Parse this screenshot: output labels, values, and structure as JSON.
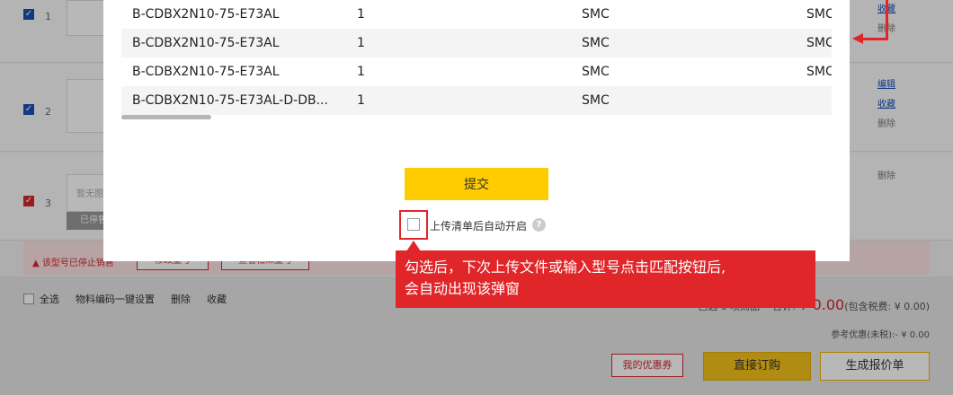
{
  "cart": {
    "rows": [
      {
        "index": "1",
        "links": [
          "收藏",
          "删除"
        ]
      },
      {
        "index": "2",
        "links": [
          "编辑",
          "收藏",
          "删除"
        ]
      },
      {
        "index": "3",
        "links": [
          "删除"
        ],
        "thumb_text": "暂无图",
        "status": "已停售"
      }
    ],
    "warning": {
      "text": "该型号已停止销售",
      "buttons": [
        "修改型号",
        "查看相似型号"
      ]
    }
  },
  "footer": {
    "select_all": "全选",
    "actions": [
      "物料编码一键设置",
      "删除",
      "收藏"
    ],
    "selected_prefix": "已选",
    "selected_count": "0",
    "selected_suffix": "项商品",
    "total_label": "合计:",
    "total": "¥ 0.00",
    "tax_note": "(包含税费: ¥ 0.00)",
    "ref_discount": "参考优惠(未税):- ¥ 0.00",
    "coupon": "我的优惠券",
    "order_btn": "直接订购",
    "quote_btn": "生成报价单"
  },
  "modal": {
    "rows": [
      {
        "model": "B-CDBX2N10-75-E73AL",
        "qty": "1",
        "brand": "SMC",
        "brand2": "SMC"
      },
      {
        "model": "B-CDBX2N10-75-E73AL",
        "qty": "1",
        "brand": "SMC",
        "brand2": "SMC"
      },
      {
        "model": "B-CDBX2N10-75-E73AL",
        "qty": "1",
        "brand": "SMC",
        "brand2": "SMC"
      },
      {
        "model": "B-CDBX2N10-75-E73AL-D-DB...",
        "qty": "1",
        "brand": "SMC",
        "brand2": ""
      }
    ],
    "submit": "提交",
    "auto_open_label": "上传清单后自动开启",
    "help": "?"
  },
  "annotation": {
    "callout_line1": "勾选后，下次上传文件或输入型号点击匹配按钮后,",
    "callout_line2": "会自动出现该弹窗"
  }
}
